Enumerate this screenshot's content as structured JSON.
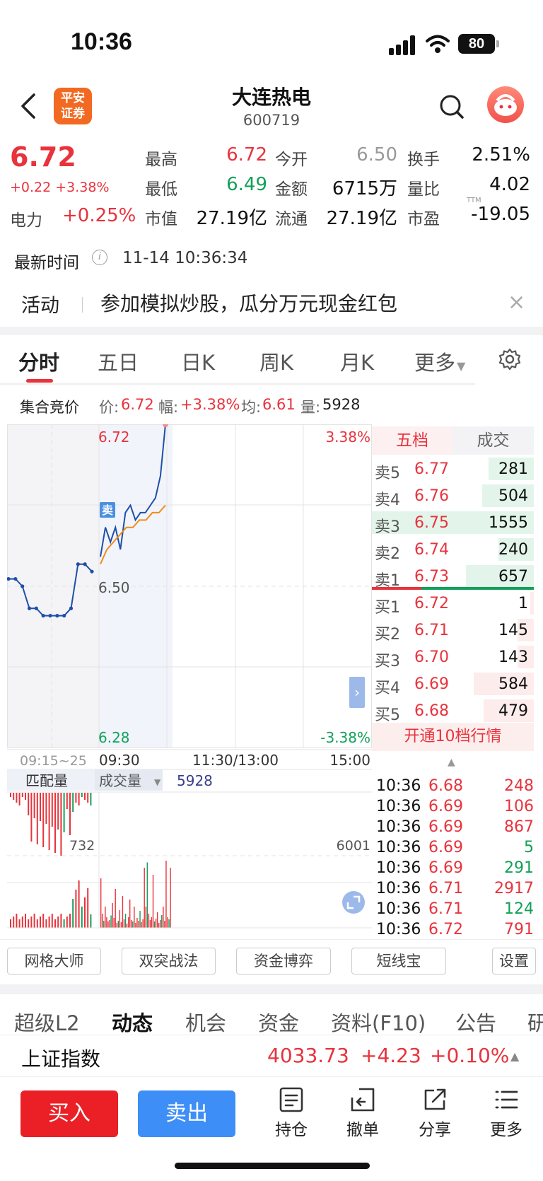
{
  "status_bar": {
    "time": "10:36",
    "battery": "80"
  },
  "header": {
    "logo_line1": "平安",
    "logo_line2": "证券",
    "stock_name": "大连热电",
    "stock_code": "600719"
  },
  "quote": {
    "price": "6.72",
    "change": "+0.22 +3.38%",
    "sector_label": "电力",
    "sector_change": "+0.25%",
    "fields": [
      {
        "label": "最高",
        "value": "6.72",
        "color": "red"
      },
      {
        "label": "今开",
        "value": "6.50",
        "color": "gray"
      },
      {
        "label": "换手",
        "value": "2.51%",
        "color": "black"
      },
      {
        "label": "最低",
        "value": "6.49",
        "color": "green"
      },
      {
        "label": "金额",
        "value": "6715万",
        "color": "black"
      },
      {
        "label": "量比",
        "value": "4.02",
        "color": "black"
      },
      {
        "label": "市值",
        "value": "27.19亿",
        "color": "black"
      },
      {
        "label": "流通",
        "value": "27.19亿",
        "color": "black"
      },
      {
        "label": "市盈",
        "value": "-19.05",
        "color": "black"
      }
    ],
    "ttm": "TTM"
  },
  "latest_time": {
    "label": "最新时间",
    "info_icon": "i",
    "value": "11-14 10:36:34"
  },
  "activity": {
    "label": "活动",
    "text": "参加模拟炒股，瓜分万元现金红包",
    "close": "×"
  },
  "tabs": [
    "分时",
    "五日",
    "日K",
    "周K",
    "月K",
    "更多"
  ],
  "info_row": {
    "title": "集合竞价",
    "price_label": "价:",
    "price": "6.72",
    "range_label": "幅:",
    "range": "+3.38%",
    "avg_label": "均:",
    "avg": "6.61",
    "vol_label": "量:",
    "vol": "5928"
  },
  "chart": {
    "y_top": "6.72",
    "y_mid": "6.50",
    "y_bottom": "6.28",
    "pct_top": "3.38%",
    "pct_bottom": "-3.38%",
    "x_labels": [
      "09:15~25",
      "09:30",
      "11:30/13:00",
      "15:00"
    ],
    "sell_marker": "卖",
    "volume_tab_left": "匹配量",
    "volume_tab_right": "成交量",
    "volume_value": "5928",
    "vol_left_label": "732",
    "vol_right_label": "6001"
  },
  "chart_data": {
    "type": "line",
    "series": [
      {
        "values": [
          6.51,
          6.51,
          6.5,
          6.47,
          6.47,
          6.46,
          6.46,
          6.46,
          6.46,
          6.47,
          6.53,
          6.53,
          6.52
        ]
      },
      {
        "values": [
          6.54,
          6.58,
          6.56,
          6.58,
          6.55,
          6.6,
          6.61,
          6.59,
          6.6,
          6.6,
          6.61,
          6.62,
          6.65,
          6.72
        ]
      },
      {
        "values": [
          6.53,
          6.55,
          6.56,
          6.57,
          6.58,
          6.58,
          6.59,
          6.59,
          6.6,
          6.6,
          6.61
        ]
      }
    ],
    "ylim": [
      6.28,
      6.72
    ]
  },
  "order_book": {
    "tab_left": "五档",
    "tab_right": "成交",
    "asks": [
      {
        "label": "卖5",
        "price": "6.77",
        "vol": "281",
        "bar": 0.28
      },
      {
        "label": "卖4",
        "price": "6.76",
        "vol": "504",
        "bar": 0.32
      },
      {
        "label": "卖3",
        "price": "6.75",
        "vol": "1555",
        "bar": 1.0
      },
      {
        "label": "卖2",
        "price": "6.74",
        "vol": "240",
        "bar": 0.22
      },
      {
        "label": "卖1",
        "price": "6.73",
        "vol": "657",
        "bar": 0.42
      }
    ],
    "bids": [
      {
        "label": "买1",
        "price": "6.72",
        "vol": "1",
        "bar": 0.02
      },
      {
        "label": "买2",
        "price": "6.71",
        "vol": "145",
        "bar": 0.1
      },
      {
        "label": "买3",
        "price": "6.70",
        "vol": "143",
        "bar": 0.1
      },
      {
        "label": "买4",
        "price": "6.69",
        "vol": "584",
        "bar": 0.37
      },
      {
        "label": "买5",
        "price": "6.68",
        "vol": "479",
        "bar": 0.31
      }
    ],
    "open_level10": "开通10档行情",
    "ticks": [
      {
        "time": "10:36",
        "price": "6.68",
        "vol": "248",
        "pc": "red",
        "vc": "red"
      },
      {
        "time": "10:36",
        "price": "6.69",
        "vol": "106",
        "pc": "red",
        "vc": "red"
      },
      {
        "time": "10:36",
        "price": "6.69",
        "vol": "867",
        "pc": "red",
        "vc": "red"
      },
      {
        "time": "10:36",
        "price": "6.69",
        "vol": "5",
        "pc": "red",
        "vc": "green"
      },
      {
        "time": "10:36",
        "price": "6.69",
        "vol": "291",
        "pc": "red",
        "vc": "green"
      },
      {
        "time": "10:36",
        "price": "6.71",
        "vol": "2917",
        "pc": "red",
        "vc": "red"
      },
      {
        "time": "10:36",
        "price": "6.71",
        "vol": "124",
        "pc": "red",
        "vc": "green"
      },
      {
        "time": "10:36",
        "price": "6.72",
        "vol": "791",
        "pc": "red",
        "vc": "red"
      }
    ]
  },
  "tools": [
    "网格大师",
    "双突战法",
    "资金博弈",
    "短线宝",
    "设置"
  ],
  "bottom_tabs": [
    "超级L2",
    "动态",
    "机会",
    "资金",
    "资料(F10)",
    "公告",
    "研"
  ],
  "index_bar": {
    "name": "上证指数",
    "value": "4033.73",
    "change": "+4.23",
    "pct": "+0.10%"
  },
  "actions": {
    "buy": "买入",
    "sell": "卖出",
    "hold": "持仓",
    "cancel": "撤单",
    "share": "分享",
    "more": "更多"
  },
  "colors": {
    "up": "#e8333c",
    "down": "#13a05a",
    "price_line": "#1f4fa8",
    "avg_line": "#f08c1a",
    "sell_button": "#3d8ef7",
    "buy_button": "#ea2026"
  }
}
